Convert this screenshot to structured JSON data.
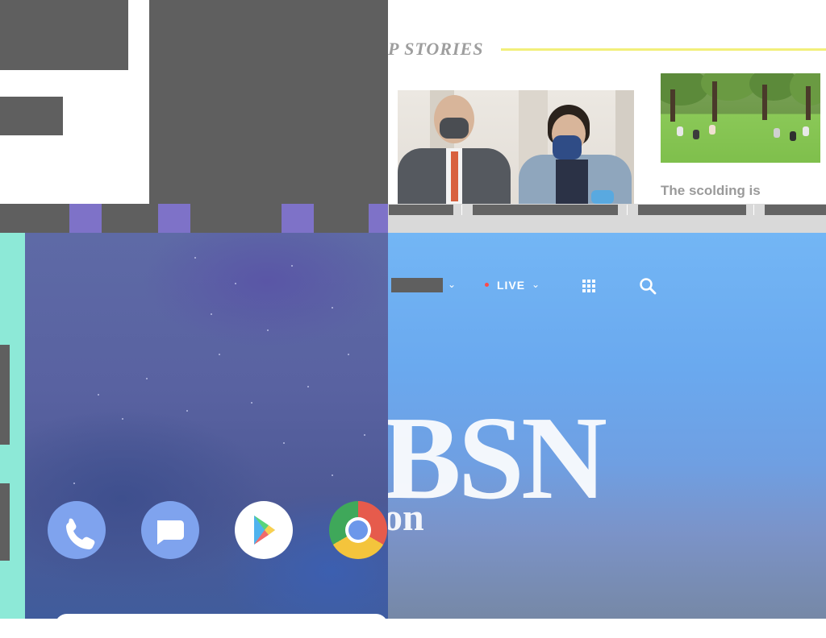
{
  "website": {
    "section_title": "P STORIES",
    "headline": "The scolding is"
  },
  "network": {
    "live_label": "LIVE",
    "brand": "BSN",
    "brand_suffix": "on"
  },
  "icons": {
    "phone": "phone-icon",
    "messages": "messages-icon",
    "play_store": "play-store-icon",
    "chrome": "chrome-icon",
    "grid": "grid-icon",
    "search": "search-icon",
    "chevron": "chevron-down-icon"
  },
  "colors": {
    "redaction": "#5f5f5f",
    "accent_rule": "#f2ef7a",
    "teal": "#8de9d7",
    "network_blue": "#73b6f5",
    "live_dot": "#ff4a4a"
  }
}
